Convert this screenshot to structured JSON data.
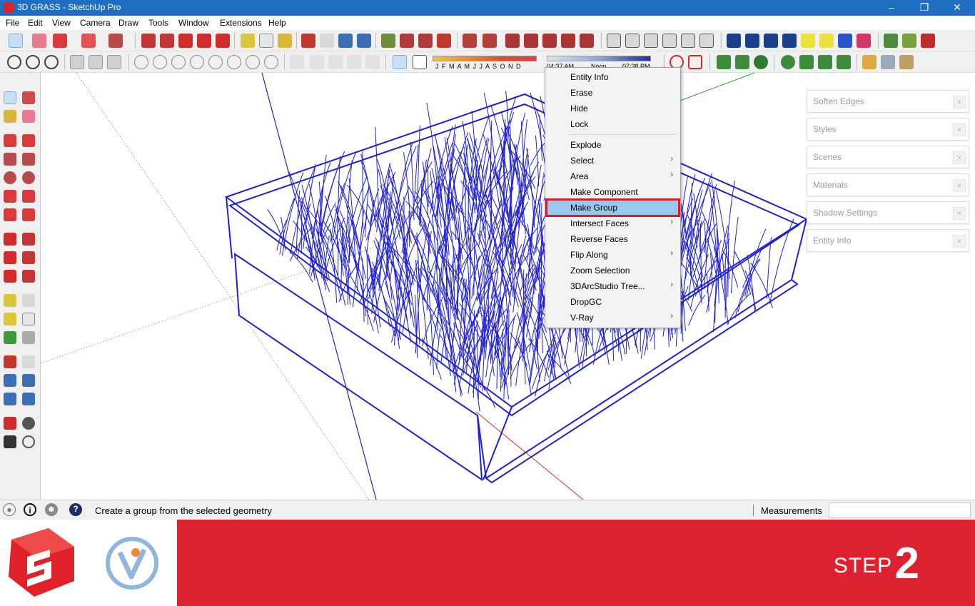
{
  "window": {
    "title": "3D GRASS - SketchUp Pro"
  },
  "menu": [
    "File",
    "Edit",
    "View",
    "Camera",
    "Draw",
    "Tools",
    "Window",
    "Extensions",
    "Help"
  ],
  "shadow_slider": {
    "months": "J F M A M J J A S O N D",
    "time_start": "04:37 AM",
    "time_mid": "Noon",
    "time_end": "07:38 PM"
  },
  "context_menu": {
    "items": [
      {
        "label": "Entity Info",
        "submenu": false
      },
      {
        "label": "Erase",
        "submenu": false
      },
      {
        "label": "Hide",
        "submenu": false
      },
      {
        "label": "Lock",
        "submenu": false
      },
      {
        "label": "Explode",
        "submenu": false
      },
      {
        "label": "Select",
        "submenu": true
      },
      {
        "label": "Area",
        "submenu": true
      },
      {
        "label": "Make Component",
        "submenu": false
      },
      {
        "label": "Make Group",
        "submenu": false,
        "highlighted": true
      },
      {
        "label": "Intersect Faces",
        "submenu": true
      },
      {
        "label": "Reverse Faces",
        "submenu": false
      },
      {
        "label": "Flip Along",
        "submenu": true
      },
      {
        "label": "Zoom Selection",
        "submenu": false
      },
      {
        "label": "3DArcStudio Tree...",
        "submenu": true
      },
      {
        "label": "DropGC",
        "submenu": false
      },
      {
        "label": "V-Ray",
        "submenu": true
      }
    ]
  },
  "tray": [
    "Soften Edges",
    "Styles",
    "Scenes",
    "Materials",
    "Shadow Settings",
    "Entity Info"
  ],
  "status": {
    "text": "Create a group from the selected geometry",
    "measurements_label": "Measurements",
    "measurements_value": ""
  },
  "banner": {
    "step_word": "STEP",
    "step_number": "2"
  },
  "colors": {
    "titlebar": "#1e6fc2",
    "banner_red": "#dc2230",
    "selection_blue": "#1f1fd6",
    "highlight_outline": "#d0202a"
  }
}
